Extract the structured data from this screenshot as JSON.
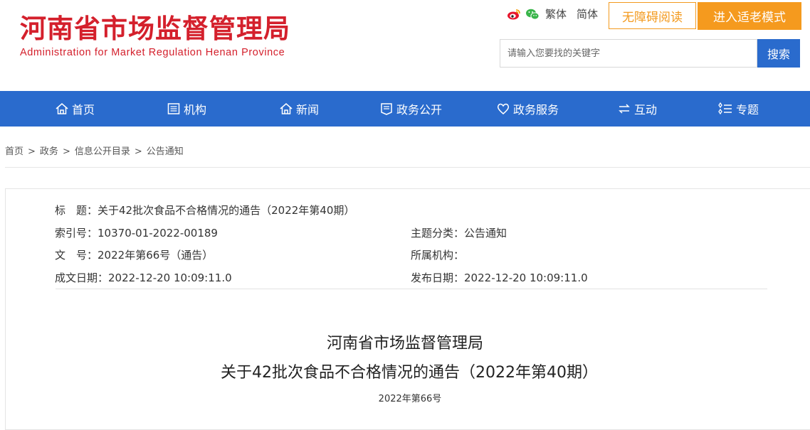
{
  "header": {
    "title": "河南省市场监督管理局",
    "subtitle": "Administration for Market Regulation Henan Province",
    "social_icons": [
      "weibo-icon",
      "wechat-icon"
    ],
    "lang_traditional": "繁体",
    "lang_simplified": "简体",
    "accessibility_label": "无障碍阅读",
    "elder_mode_label": "进入适老模式",
    "search_placeholder": "请输入您要找的关键字",
    "search_button": "搜索"
  },
  "nav": {
    "items": [
      {
        "label": "首页",
        "icon": "home-icon"
      },
      {
        "label": "机构",
        "icon": "list-icon"
      },
      {
        "label": "新闻",
        "icon": "home-icon"
      },
      {
        "label": "政务公开",
        "icon": "badge-icon"
      },
      {
        "label": "政务服务",
        "icon": "heart-icon"
      },
      {
        "label": "互动",
        "icon": "exchange-icon"
      },
      {
        "label": "专题",
        "icon": "topic-list-icon"
      }
    ]
  },
  "breadcrumb": {
    "items": [
      "首页",
      "政务",
      "信息公开目录",
      "公告通知"
    ],
    "separator": ">"
  },
  "meta": {
    "title_label": "标　题：",
    "title_value": "关于42批次食品不合格情况的通告（2022年第40期）",
    "index_label": "索引号：",
    "index_value": "10370-01-2022-00189",
    "topic_label": "主题分类：",
    "topic_value": "公告通知",
    "docno_label": "文　号：",
    "docno_value": "2022年第66号（通告）",
    "org_label": "所属机构：",
    "org_value": "",
    "created_label": "成文日期：",
    "created_value": "2022-12-20 10:09:11.0",
    "published_label": "发布日期：",
    "published_value": "2022-12-20 10:09:11.0"
  },
  "document": {
    "heading_line1": "河南省市场监督管理局",
    "heading_line2": "关于42批次食品不合格情况的通告（2022年第40期）",
    "number": "2022年第66号"
  },
  "colors": {
    "brand_red": "#d4202c",
    "nav_blue": "#2a6bcd",
    "accent_orange": "#f59a1e"
  }
}
